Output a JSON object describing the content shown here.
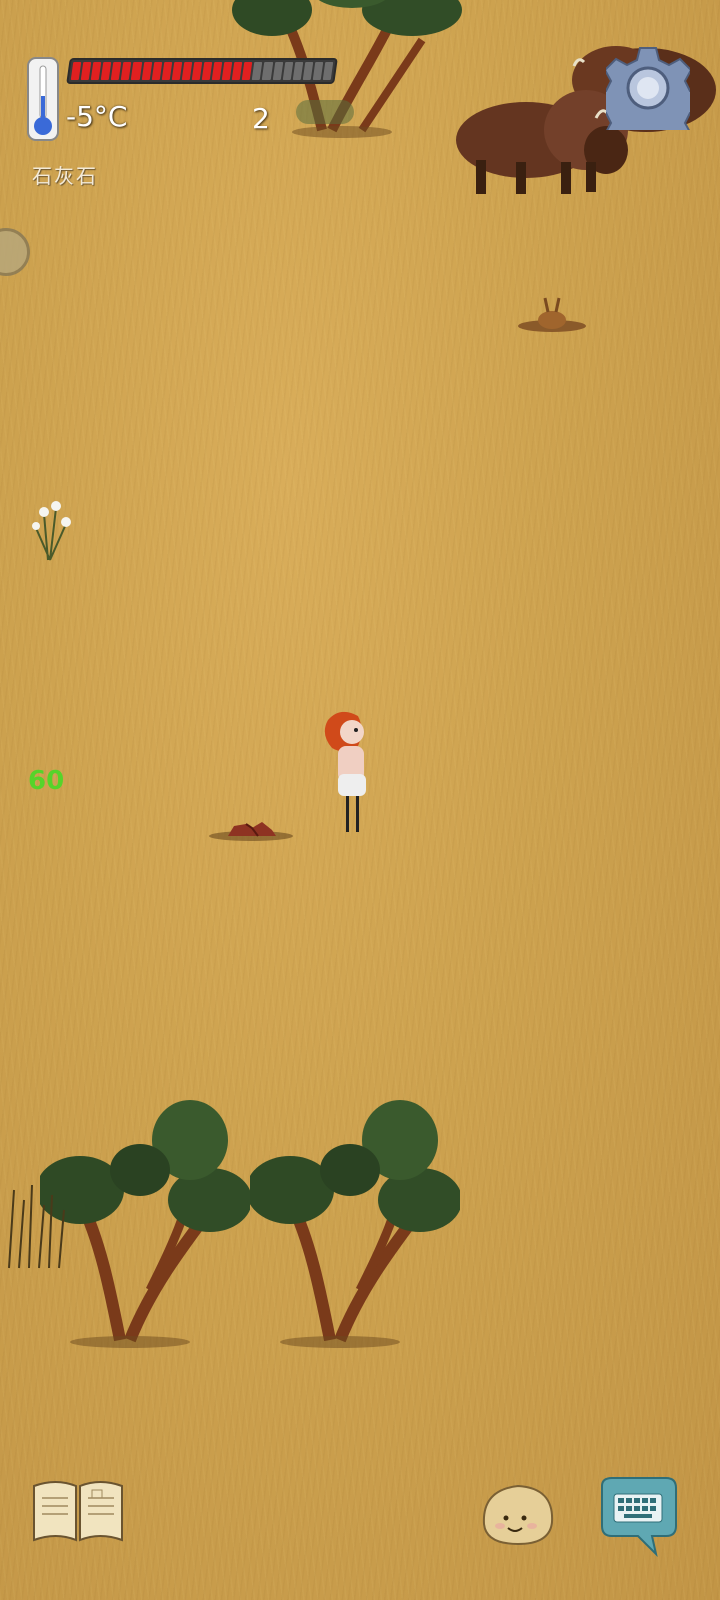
{
  "hud": {
    "temperature": "-5°C",
    "health_fraction": 0.7,
    "level": "2",
    "xp_label": "",
    "held_item": "石灰石",
    "fps": "60"
  },
  "colors": {
    "health_fill": "#e02020",
    "health_empty": "#6e6e6e",
    "fps": "#55d42a",
    "ground": "#cda24f"
  },
  "icons": {
    "settings": "gear-icon",
    "journal": "book-icon",
    "emote": "emote-face-icon",
    "chat": "keyboard-icon",
    "temperature": "thermometer-icon"
  }
}
